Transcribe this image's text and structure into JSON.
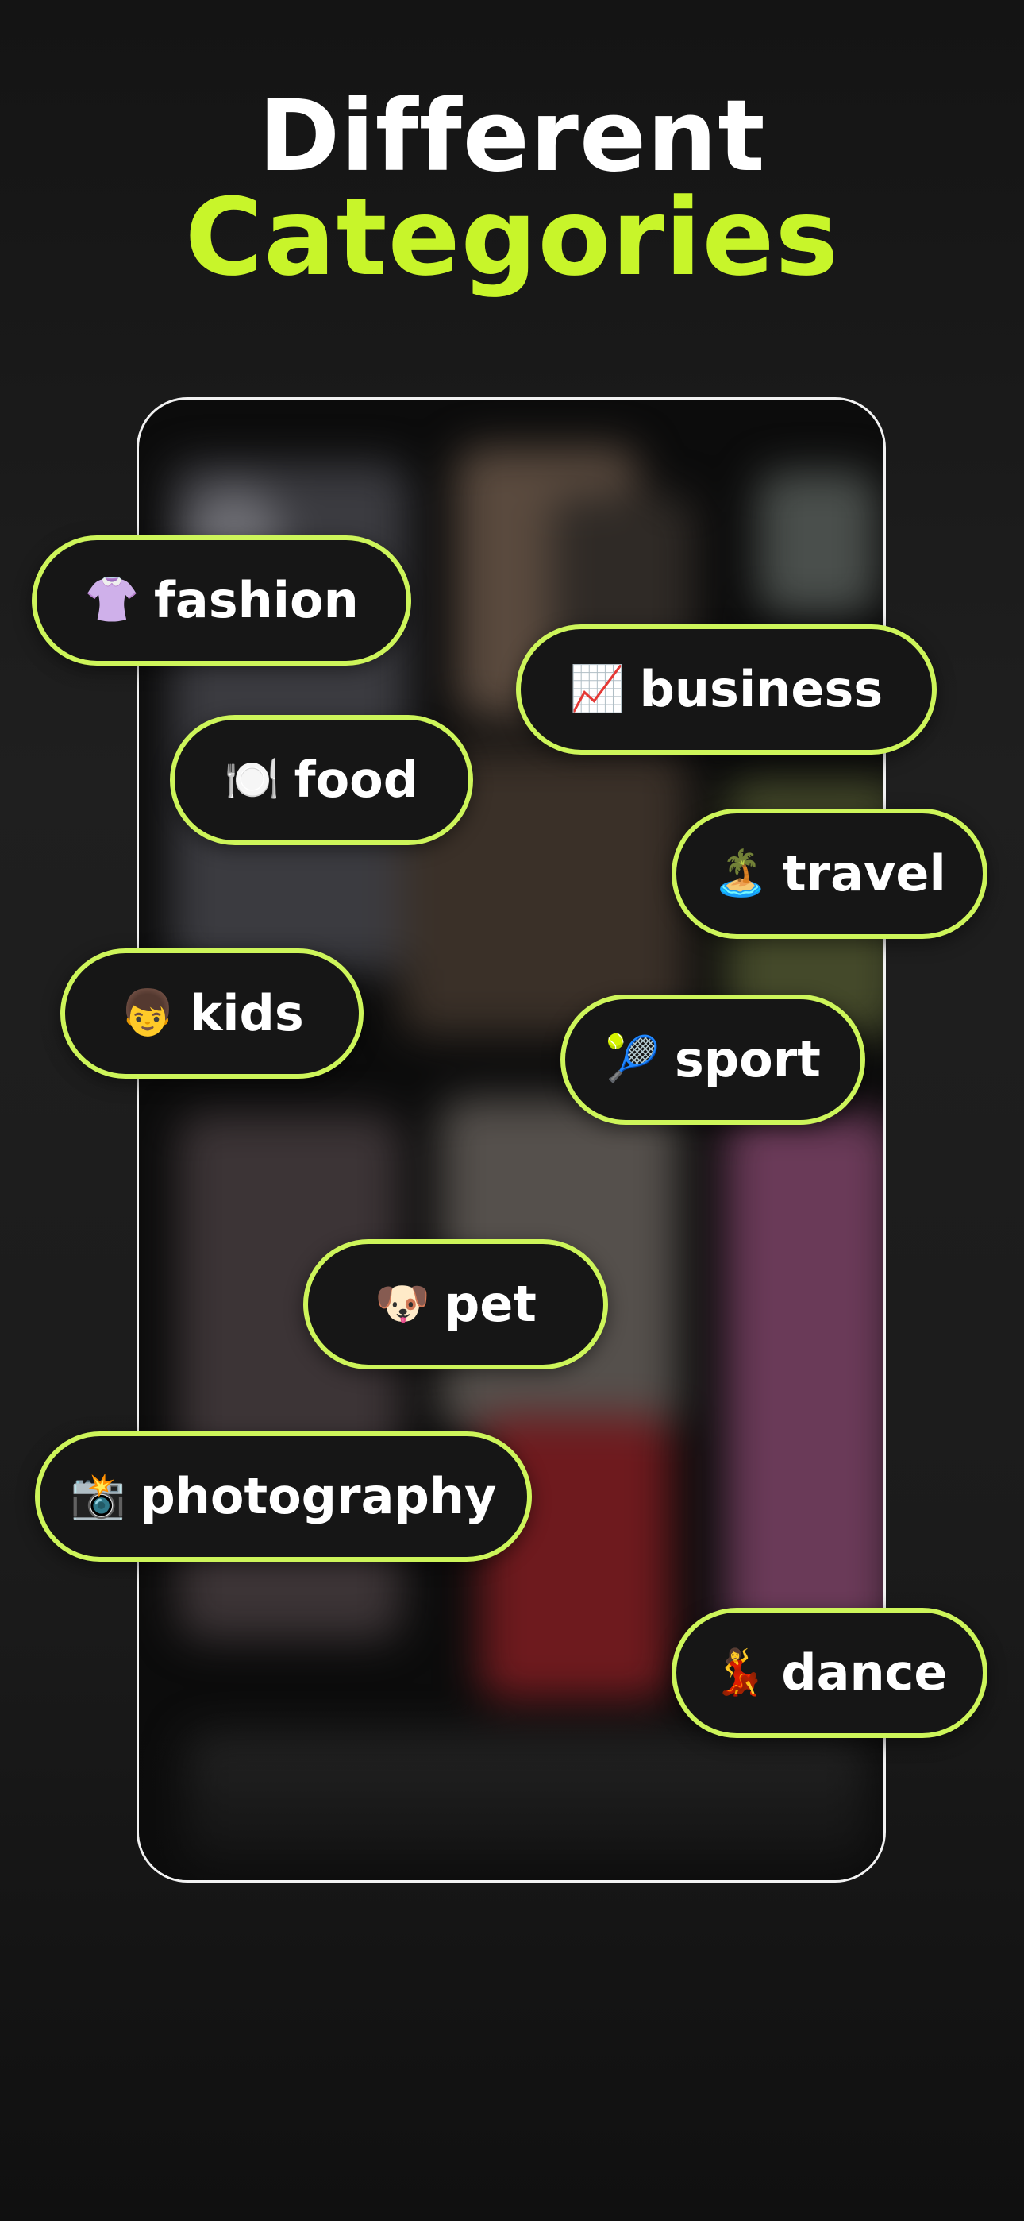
{
  "heading": {
    "line1": "Different",
    "line2": "Categories"
  },
  "colors": {
    "accent": "#c8f52a",
    "chip_border": "#cdf55a",
    "chip_background": "#161616",
    "background": "#1b1b1b",
    "text": "#ffffff"
  },
  "categories": [
    {
      "icon": "t-shirt-icon",
      "emoji": "👚",
      "label": "fashion"
    },
    {
      "icon": "chart-increasing-icon",
      "emoji": "📈",
      "label": "business"
    },
    {
      "icon": "fork-knife-plate-icon",
      "emoji": "🍽️",
      "label": "food"
    },
    {
      "icon": "beach-umbrella-icon",
      "emoji": "🏝️",
      "label": "travel"
    },
    {
      "icon": "child-face-icon",
      "emoji": "👦",
      "label": "kids"
    },
    {
      "icon": "tennis-ball-icon",
      "emoji": "🎾",
      "label": "sport"
    },
    {
      "icon": "dog-face-icon",
      "emoji": "🐶",
      "label": "pet"
    },
    {
      "icon": "camera-flash-icon",
      "emoji": "📸",
      "label": "photography"
    },
    {
      "icon": "dancer-icon",
      "emoji": "💃",
      "label": "dance"
    }
  ]
}
